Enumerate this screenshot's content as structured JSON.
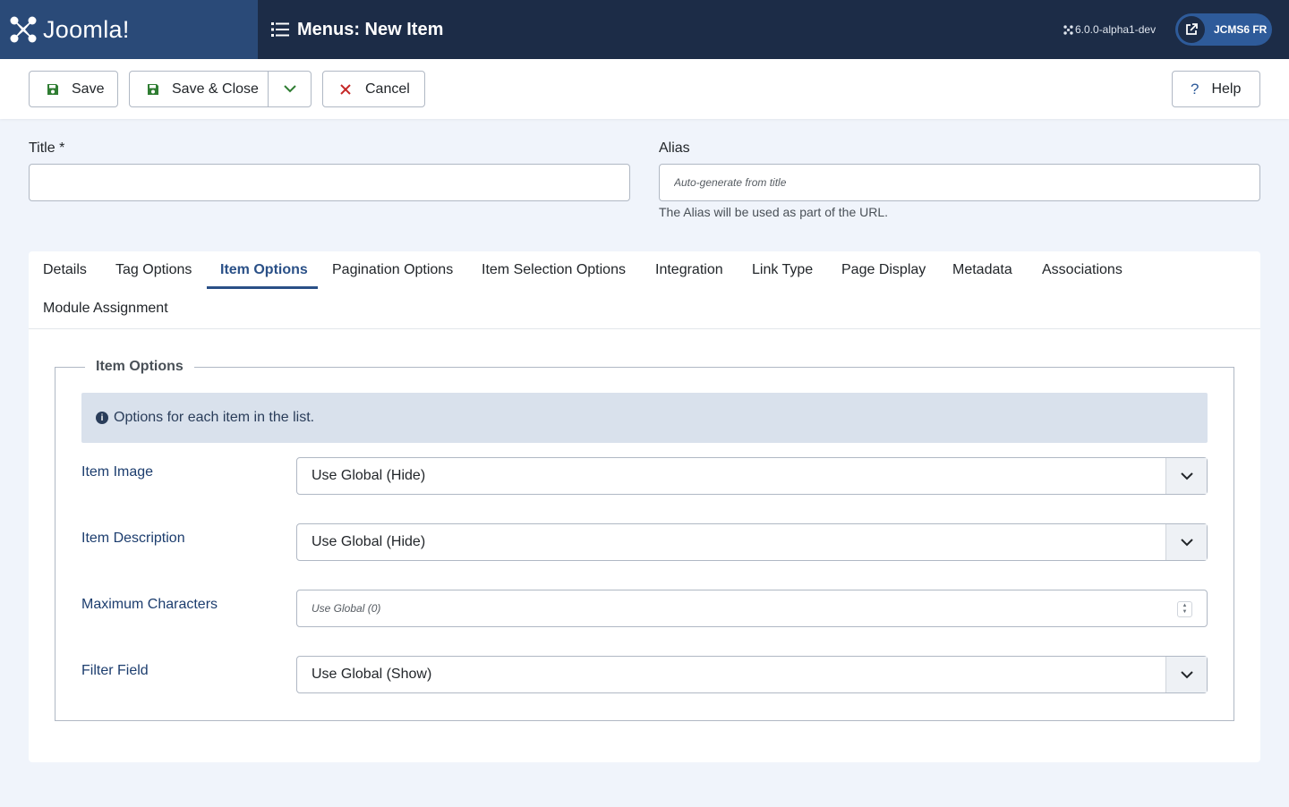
{
  "header": {
    "logo_text": "Joomla!",
    "page_title": "Menus: New Item",
    "version": "6.0.0-alpha1-dev",
    "site_button_label": "JCMS6 FR"
  },
  "toolbar": {
    "save_label": "Save",
    "save_close_label": "Save & Close",
    "cancel_label": "Cancel",
    "help_label": "Help"
  },
  "form": {
    "title_label": "Title *",
    "title_value": "",
    "alias_label": "Alias",
    "alias_placeholder": "Auto-generate from title",
    "alias_help": "The Alias will be used as part of the URL."
  },
  "tabs": [
    {
      "label": "Details",
      "active": false
    },
    {
      "label": "Tag Options",
      "active": false
    },
    {
      "label": "Item Options",
      "active": true
    },
    {
      "label": "Pagination Options",
      "active": false
    },
    {
      "label": "Item Selection Options",
      "active": false
    },
    {
      "label": "Integration",
      "active": false
    },
    {
      "label": "Link Type",
      "active": false
    },
    {
      "label": "Page Display",
      "active": false
    },
    {
      "label": "Metadata",
      "active": false
    },
    {
      "label": "Associations",
      "active": false
    },
    {
      "label": "Module Assignment",
      "active": false
    }
  ],
  "item_options": {
    "legend": "Item Options",
    "info": "Options for each item in the list.",
    "fields": [
      {
        "label": "Item Image",
        "value": "Use Global (Hide)"
      },
      {
        "label": "Item Description",
        "value": "Use Global (Hide)"
      },
      {
        "label": "Maximum Characters",
        "value": "Use Global (0)"
      },
      {
        "label": "Filter Field",
        "value": "Use Global (Show)"
      }
    ]
  },
  "colors": {
    "header_bg": "#1c2c47",
    "logo_bg": "#2a4a78",
    "accent": "#2a5087",
    "save_icon": "#2f7d32",
    "cancel_icon": "#c52827"
  }
}
